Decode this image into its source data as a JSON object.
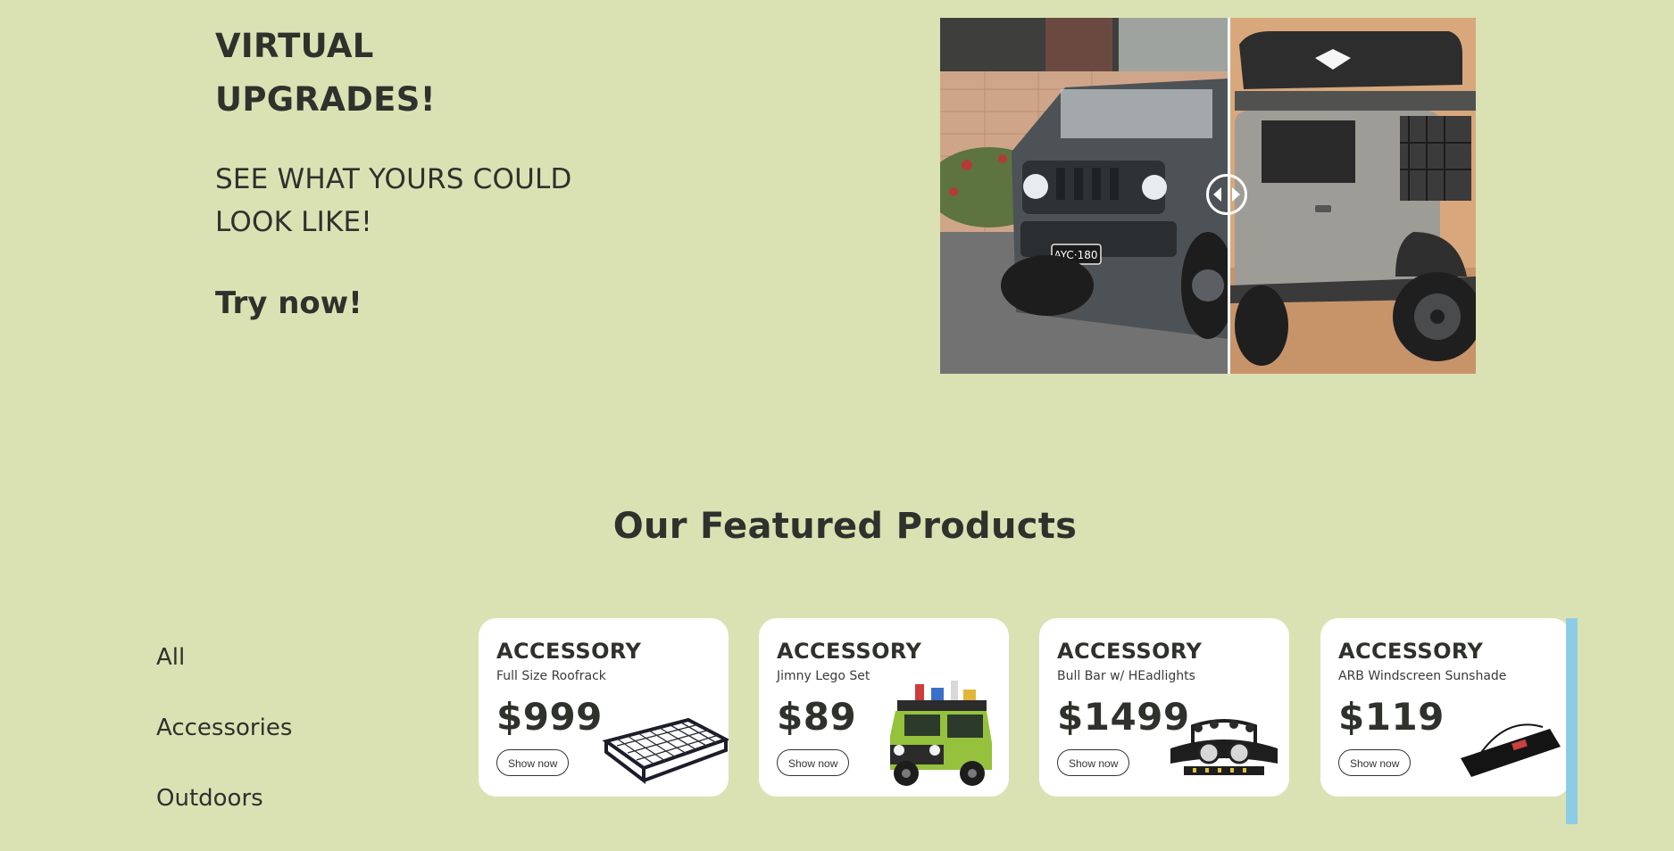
{
  "hero": {
    "title": "VIRTUAL UPGRADES!",
    "subtitle": "SEE WHAT YOURS COULD LOOK LIKE!",
    "cta": "Try now!",
    "plate_text": "AYC·180"
  },
  "featured": {
    "title": "Our Featured Products"
  },
  "filters": [
    "All",
    "Accessories",
    "Outdoors"
  ],
  "products": [
    {
      "category": "ACCESSORY",
      "name": "Full Size Roofrack",
      "price": "$999",
      "button": "Show now",
      "image": "roof-rack-image"
    },
    {
      "category": "ACCESSORY",
      "name": "Jimny Lego Set",
      "price": "$89",
      "button": "Show now",
      "image": "lego-jimny-image"
    },
    {
      "category": "ACCESSORY",
      "name": "Bull Bar w/ HEadlights",
      "price": "$1499",
      "button": "Show now",
      "image": "bull-bar-image"
    },
    {
      "category": "ACCESSORY",
      "name": "ARB Windscreen Sunshade",
      "price": "$119",
      "button": "Show now",
      "image": "sunshade-bag-image"
    }
  ],
  "colors": {
    "background": "#dae2b4",
    "text": "#2f312c",
    "card": "#ffffff",
    "scroll_accent": "#8ccde5"
  }
}
